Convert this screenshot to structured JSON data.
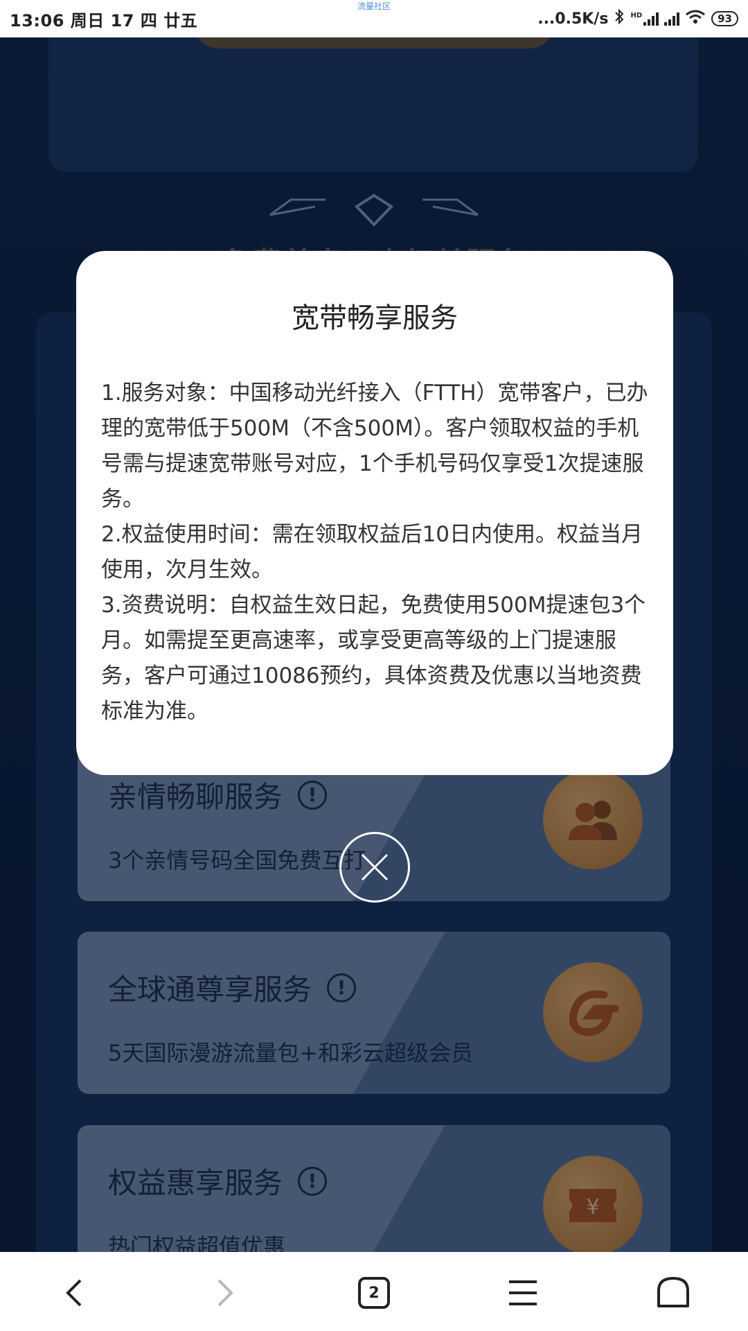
{
  "status_bar": {
    "time_date": "13:06 周日 17 四 廿五",
    "center_label": "流量社区",
    "net_speed": "...0.5K/s",
    "hd_label": "HD",
    "battery": "93"
  },
  "background": {
    "section_title": "免费尊享五大权益服务",
    "cards": [
      {
        "title": "亲情畅聊服务",
        "info": "!",
        "desc": "3个亲情号码全国免费互打",
        "icon": "family-icon"
      },
      {
        "title": "全球通尊享服务",
        "info": "!",
        "desc": "5天国际漫游流量包+和彩云超级会员",
        "icon": "global-g-icon"
      },
      {
        "title": "权益惠享服务",
        "info": "!",
        "desc": "热门权益超值优惠",
        "icon": "ticket-yen-icon"
      }
    ],
    "ticket_symbol": "¥"
  },
  "modal": {
    "title": "宽带畅享服务",
    "paragraphs": [
      "1.服务对象：中国移动光纤接入（FTTH）宽带客户，已办理的宽带低于500M（不含500M）。客户领取权益的手机号需与提速宽带账号对应，1个手机号码仅享受1次提速服务。",
      "2.权益使用时间：需在领取权益后10日内使用。权益当月使用，次月生效。",
      "3.资费说明：自权益生效日起，免费使用500M提速包3个月。如需提至更高速率，或享受更高等级的上门提速服务，客户可通过10086预约，具体资费及优惠以当地资费标准为准。"
    ]
  },
  "bottom_nav": {
    "tab_count": "2"
  },
  "colors": {
    "page_bg": "#0b1f40",
    "gold_accent": "#c6a452",
    "icon_orange": "#d68a3c"
  }
}
